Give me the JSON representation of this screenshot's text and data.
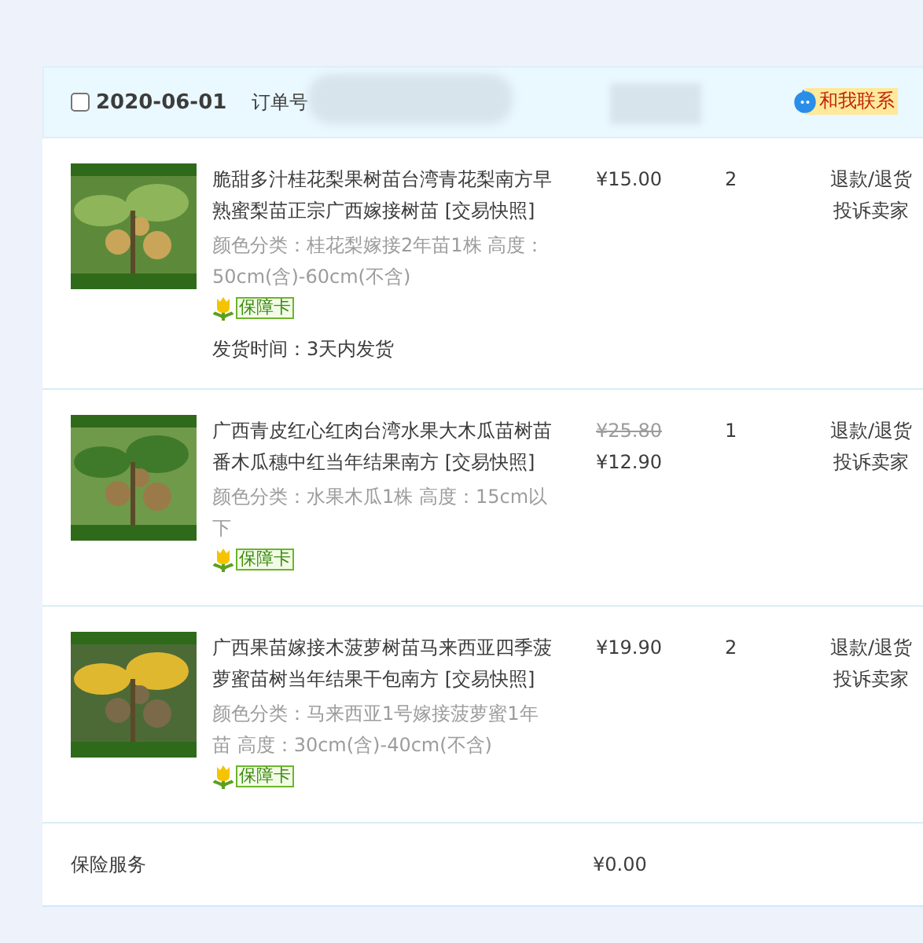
{
  "order": {
    "checked": false,
    "date": "2020-06-01",
    "order_no_label": "订单号",
    "contact": "和我联系"
  },
  "items": [
    {
      "title": "脆甜多汁桂花梨果树苗台湾青花梨南方早熟蜜梨苗正宗广西嫁接树苗",
      "snapshot": "[交易快照]",
      "spec": "颜色分类：桂花梨嫁接2年苗1株  高度：50cm(含)-60cm(不含)",
      "badge": "保障卡",
      "shipping": "发货时间：3天内发货",
      "price": "¥15.00",
      "quantity": "2",
      "actions": [
        "退款/退货",
        "投诉卖家"
      ]
    },
    {
      "title": "广西青皮红心红肉台湾水果大木瓜苗树苗番木瓜穗中红当年结果南方",
      "snapshot": "[交易快照]",
      "spec": "颜色分类：水果木瓜1株  高度：15cm以下",
      "badge": "保障卡",
      "original_price": "¥25.80",
      "price": "¥12.90",
      "quantity": "1",
      "actions": [
        "退款/退货",
        "投诉卖家"
      ]
    },
    {
      "title": "广西果苗嫁接木菠萝树苗马来西亚四季菠萝蜜苗树当年结果干包南方",
      "snapshot": "[交易快照]",
      "spec": "颜色分类：马来西亚1号嫁接菠萝蜜1年苗  高度：30cm(含)-40cm(不含)",
      "badge": "保障卡",
      "price": "¥19.90",
      "quantity": "2",
      "actions": [
        "退款/退货",
        "投诉卖家"
      ]
    }
  ],
  "insurance": {
    "label": "保险服务",
    "price": "¥0.00"
  }
}
